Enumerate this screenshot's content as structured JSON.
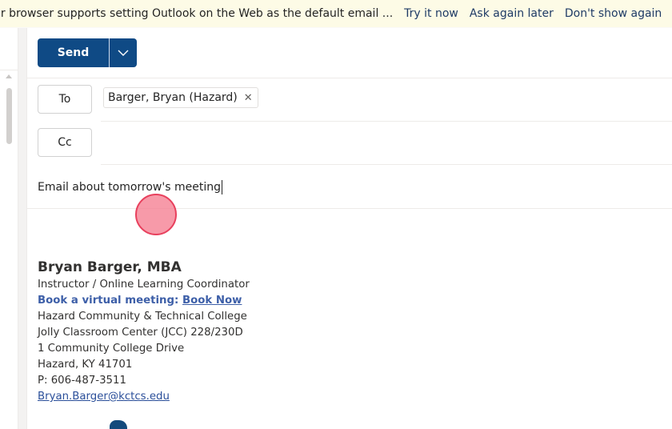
{
  "banner": {
    "message": "ur browser supports setting Outlook on the Web as the default email ...",
    "actions": [
      "Try it now",
      "Ask again later",
      "Don't show again"
    ]
  },
  "compose": {
    "send_label": "Send",
    "send_options_icon": "chevron-down-icon",
    "to_label": "To",
    "cc_label": "Cc",
    "to_recipients": [
      {
        "name": "Barger, Bryan (Hazard)",
        "remove_icon": "close-icon"
      }
    ],
    "cc_recipients": [],
    "subject": "Email about tomorrow's meeting"
  },
  "signature": {
    "name": "Bryan Barger, MBA",
    "title": "Instructor / Online Learning Coordinator",
    "book_prefix": "Book a virtual meeting: ",
    "book_link": "Book Now",
    "college": "Hazard Community & Technical College",
    "office": "Jolly Classroom Center (JCC) 228/230D",
    "street": "1 Community College Drive",
    "city": "Hazard, KY 41701",
    "phone": "P: 606-487-3511",
    "email": "Bryan.Barger@kctcs.edu"
  },
  "colors": {
    "accent": "#0f4a85",
    "banner_bg": "#fdfbe6",
    "link": "#3d5fa8",
    "click_indicator": "#e8405d"
  }
}
